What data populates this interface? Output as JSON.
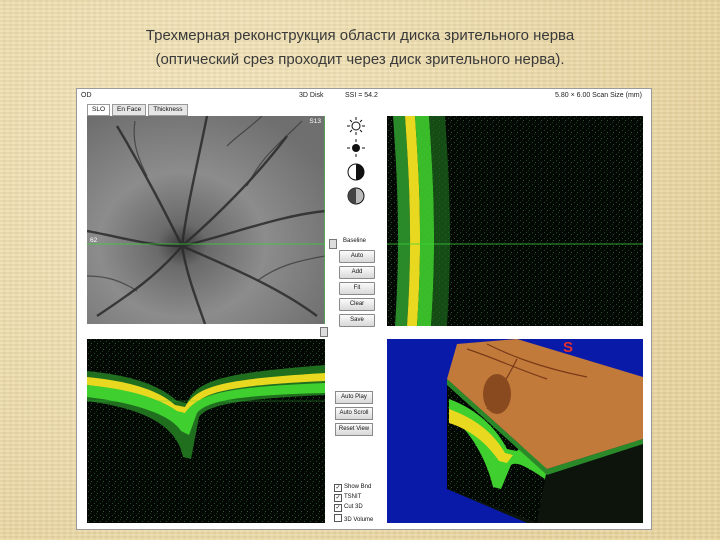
{
  "slide": {
    "title_line1": "Трехмерная реконструкция области диска  зрительного нерва",
    "title_line2": "(оптический срез проходит через диск зрительного нерва)."
  },
  "topbar": {
    "eye": "OD",
    "mode": "3D Disk",
    "ssi": "SSI = 54.2",
    "scan_size": "5.80 × 6.00 Scan Size (mm)"
  },
  "tabs": [
    {
      "label": "SLO",
      "active": true
    },
    {
      "label": "En Face",
      "active": false
    },
    {
      "label": "Thickness",
      "active": false
    }
  ],
  "fundus": {
    "label_top": "S13",
    "label_left": "62"
  },
  "controls": {
    "section_label": "Baseline",
    "buttons": [
      "Auto",
      "Add",
      "Fit",
      "Clear",
      "Save"
    ]
  },
  "lower_controls": {
    "buttons": [
      "Auto Play",
      "Auto Scroll",
      "Reset View"
    ],
    "checkboxes": [
      {
        "label": "Show Bnd",
        "checked": true
      },
      {
        "label": "TSNIT",
        "checked": true
      },
      {
        "label": "Cut 3D",
        "checked": true
      },
      {
        "label": "3D Volume",
        "checked": false
      }
    ]
  },
  "view3d": {
    "axis_label": "S"
  },
  "colors": {
    "background": "#efe0b0",
    "view3d": "#0a1aa8",
    "retina_green": "#3fcf2f",
    "retina_yellow": "#f0e020"
  }
}
